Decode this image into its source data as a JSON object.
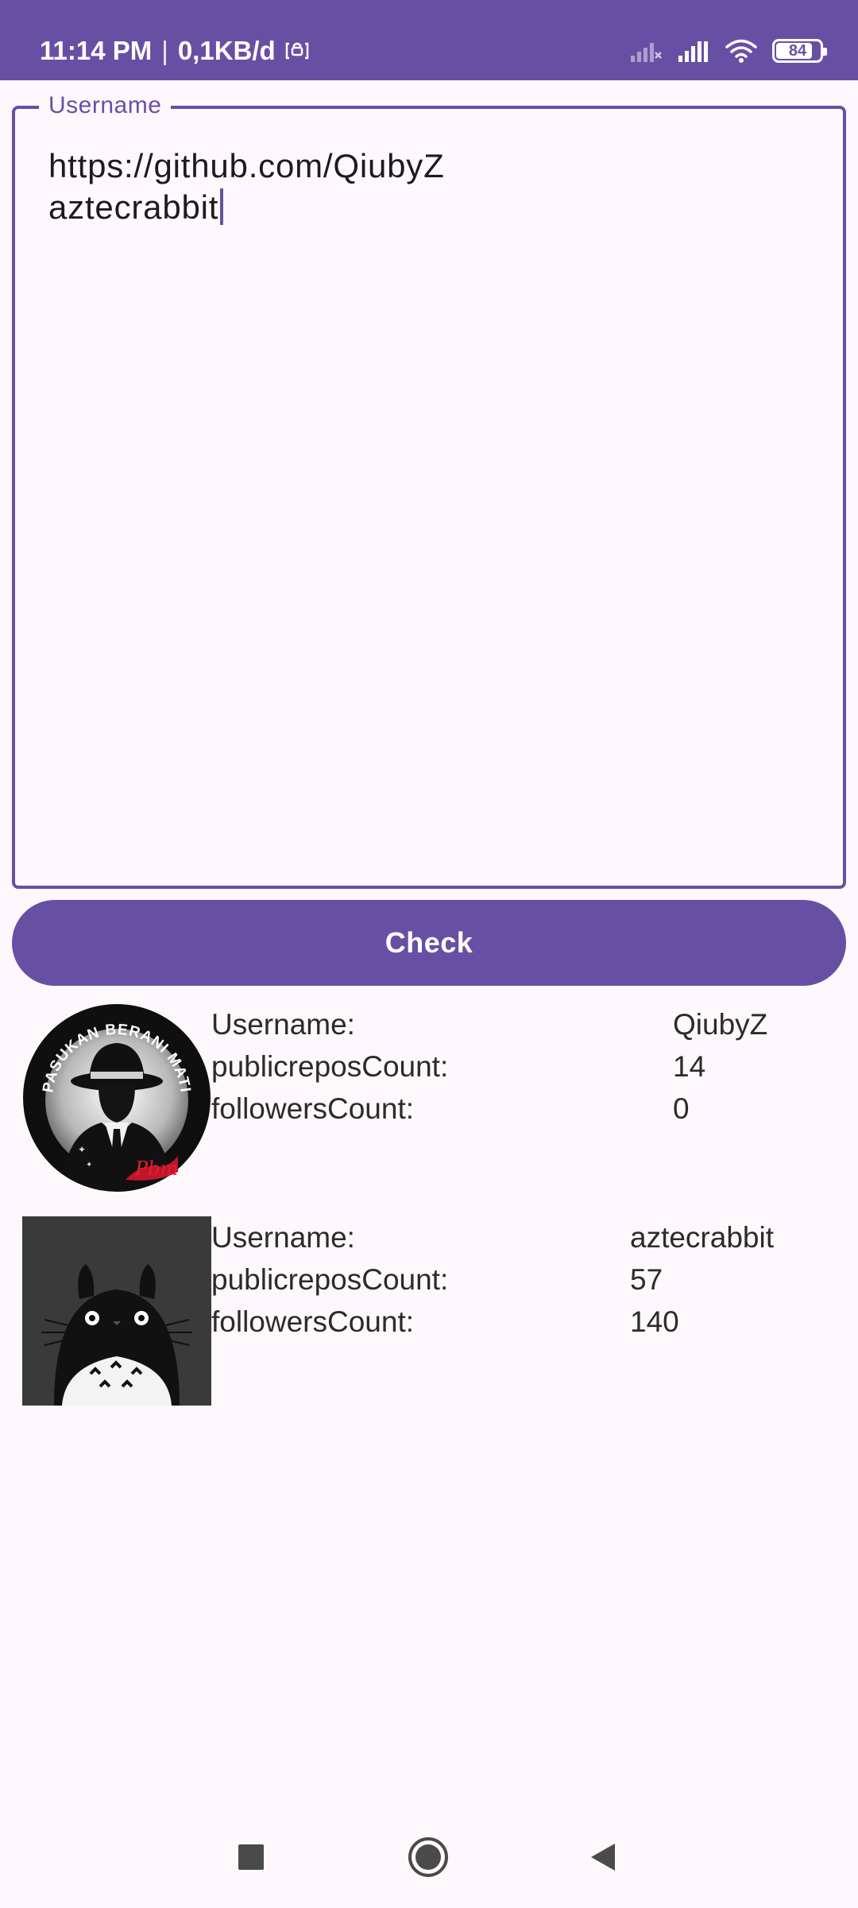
{
  "status_bar": {
    "time": "11:14 PM",
    "separator": "|",
    "data_rate": "0,1KB/d",
    "battery_level": "84",
    "battery_fraction": 0.84,
    "icons": [
      "vpn-icon",
      "signal-icon-empty",
      "signal-icon-full",
      "wifi-icon",
      "battery-icon"
    ]
  },
  "username_field": {
    "label": "Username",
    "lines": [
      "https://github.com/QiubyZ",
      "aztecrabbit"
    ]
  },
  "check_button": {
    "label": "Check"
  },
  "results": [
    {
      "avatar": "mafia-hat-avatar",
      "avatar_text": "PASUKAN BERANI MATI",
      "rows": [
        {
          "key": "Username:",
          "value": "QiubyZ"
        },
        {
          "key": "publicreposCount:",
          "value": "14"
        },
        {
          "key": "followersCount:",
          "value": "0"
        }
      ]
    },
    {
      "avatar": "totoro-avatar",
      "rows": [
        {
          "key": "Username:",
          "value": "aztecrabbit"
        },
        {
          "key": "publicreposCount:",
          "value": "57"
        },
        {
          "key": "followersCount:",
          "value": "140"
        }
      ]
    }
  ],
  "nav_bar": {
    "buttons": [
      "recents-icon",
      "home-icon",
      "back-icon"
    ]
  },
  "colors": {
    "primary": "#6750a4",
    "background": "#fef8fc",
    "on_primary": "#ffffff"
  }
}
